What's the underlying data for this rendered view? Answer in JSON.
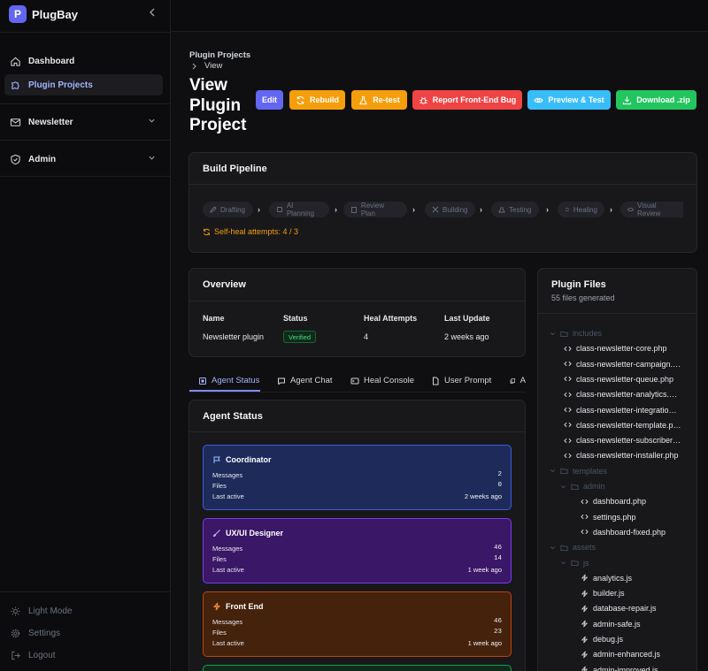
{
  "app": {
    "name": "PlugBay",
    "logo_letter": "P"
  },
  "nav": {
    "dashboard": "Dashboard",
    "plugin_projects": "Plugin Projects",
    "newsletter": "Newsletter",
    "admin": "Admin"
  },
  "footer": {
    "light_mode": "Light Mode",
    "settings": "Settings",
    "logout": "Logout"
  },
  "breadcrumb": {
    "parent": "Plugin Projects",
    "current": "View"
  },
  "page": {
    "title": "View Plugin Project"
  },
  "actions": {
    "edit": "Edit",
    "rebuild": "Rebuild",
    "retest": "Re-test",
    "report": "Report Front-End Bug",
    "preview": "Preview & Test",
    "download": "Download .zip"
  },
  "pipeline": {
    "title": "Build Pipeline",
    "steps": [
      "Drafting",
      "AI Planning",
      "Review Plan",
      "Building",
      "Testing",
      "Healing",
      "Visual Review"
    ],
    "heal_text": "Self-heal attempts: 4 / 3"
  },
  "overview": {
    "title": "Overview",
    "headers": [
      "Name",
      "Status",
      "Heal Attempts",
      "Last Update"
    ],
    "name": "Newsletter plugin",
    "status": "Verified",
    "heal": "4",
    "updated": "2 weeks ago"
  },
  "tabs": [
    "Agent Status",
    "Agent Chat",
    "Heal Console",
    "User Prompt",
    "A"
  ],
  "agent_status": {
    "title": "Agent Status",
    "labels": {
      "messages": "Messages",
      "files": "Files",
      "last_active": "Last active"
    },
    "agents": [
      {
        "name": "Coordinator",
        "messages": "2",
        "files": "0",
        "last_active": "2 weeks ago"
      },
      {
        "name": "UX/UI Designer",
        "messages": "46",
        "files": "14",
        "last_active": "1 week ago"
      },
      {
        "name": "Front End",
        "messages": "46",
        "files": "23",
        "last_active": "1 week ago"
      }
    ]
  },
  "colors": {
    "accent": "#6366f1",
    "edit": "#6366f1",
    "rebuild": "#f59e0b",
    "retest": "#f59e0b",
    "report": "#ef4444",
    "preview": "#38bdf8",
    "download": "#22c55e"
  },
  "files": {
    "title": "Plugin Files",
    "subtitle": "55 files generated",
    "dir_includes": "includes",
    "includes": [
      "class-newsletter-core.php",
      "class-newsletter-campaign.…",
      "class-newsletter-queue.php",
      "class-newsletter-analytics.…",
      "class-newsletter-integratio…",
      "class-newsletter-template.p…",
      "class-newsletter-subscriber…",
      "class-newsletter-installer.php"
    ],
    "dir_templates": "templates",
    "dir_admin": "admin",
    "admin": [
      "dashboard.php",
      "settings.php",
      "dashboard-fixed.php"
    ],
    "dir_assets": "assets",
    "dir_js": "js",
    "js": [
      "analytics.js",
      "builder.js",
      "database-repair.js",
      "admin-safe.js",
      "debug.js",
      "admin-enhanced.js",
      "admin-improved.js"
    ]
  }
}
